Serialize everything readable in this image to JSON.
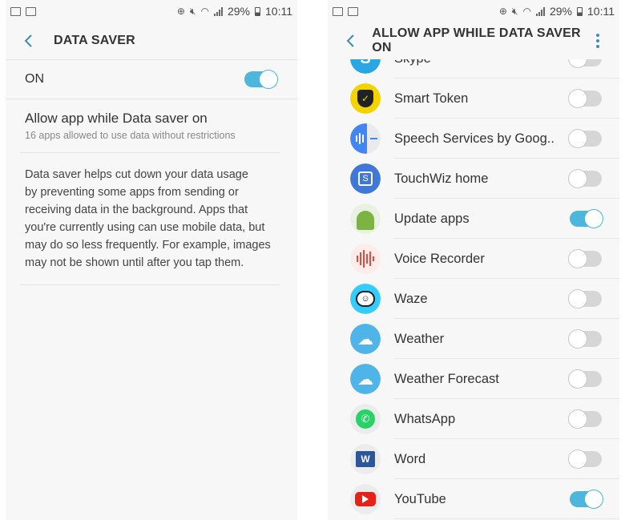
{
  "colors": {
    "accent": "#4cb6dd",
    "switch_off": "#d6d6d6"
  },
  "status_bar": {
    "left_icons": [
      "mail-icon",
      "image-icon"
    ],
    "right_icons": [
      "data-saver-icon",
      "mute-icon",
      "wifi-icon",
      "signal-icon"
    ],
    "battery": "29%",
    "time": "10:11"
  },
  "left": {
    "title": "DATA SAVER",
    "on_label": "ON",
    "on_state": true,
    "allow_title": "Allow app while Data saver on",
    "allow_sub": "16 apps allowed to use data without restrictions",
    "description_lines": [
      "Data saver helps cut down your data usage",
      "by preventing some apps from sending or",
      "receiving data in the background. Apps that",
      "you're currently using can use mobile data, but",
      "may do so less frequently. For example, images",
      "may not be shown until after you tap them."
    ]
  },
  "right": {
    "title": "ALLOW APP WHILE DATA SAVER ON",
    "apps": [
      {
        "name": "Skype",
        "icon": "skype-icon",
        "on": false
      },
      {
        "name": "Smart Token",
        "icon": "smart-token-icon",
        "on": false
      },
      {
        "name": "Speech Services by Goog..",
        "icon": "speech-services-icon",
        "on": false
      },
      {
        "name": "TouchWiz home",
        "icon": "touchwiz-home-icon",
        "on": false
      },
      {
        "name": "Update apps",
        "icon": "android-update-icon",
        "on": true
      },
      {
        "name": "Voice Recorder",
        "icon": "voice-recorder-icon",
        "on": false
      },
      {
        "name": "Waze",
        "icon": "waze-icon",
        "on": false
      },
      {
        "name": "Weather",
        "icon": "weather-icon",
        "on": false
      },
      {
        "name": "Weather Forecast",
        "icon": "weather-forecast-icon",
        "on": false
      },
      {
        "name": "WhatsApp",
        "icon": "whatsapp-icon",
        "on": false
      },
      {
        "name": "Word",
        "icon": "word-icon",
        "on": false
      },
      {
        "name": "YouTube",
        "icon": "youtube-icon",
        "on": true
      }
    ]
  }
}
